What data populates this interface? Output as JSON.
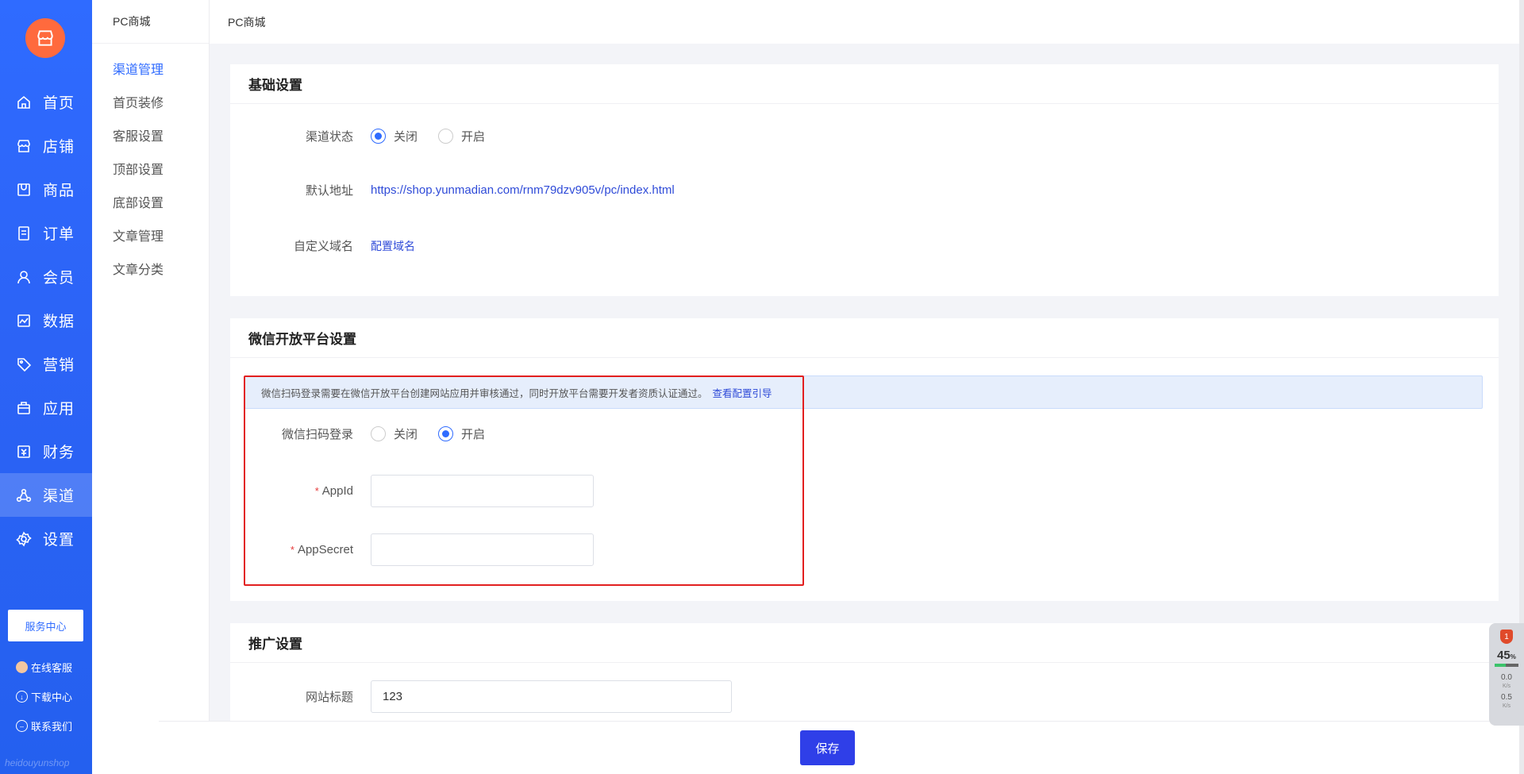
{
  "sidebar": {
    "items": [
      {
        "label": "首页",
        "icon": "home-icon"
      },
      {
        "label": "店铺",
        "icon": "store-icon"
      },
      {
        "label": "商品",
        "icon": "goods-icon"
      },
      {
        "label": "订单",
        "icon": "order-icon"
      },
      {
        "label": "会员",
        "icon": "member-icon"
      },
      {
        "label": "数据",
        "icon": "chart-icon"
      },
      {
        "label": "营销",
        "icon": "tag-icon"
      },
      {
        "label": "应用",
        "icon": "app-icon"
      },
      {
        "label": "财务",
        "icon": "finance-icon"
      },
      {
        "label": "渠道",
        "icon": "channel-icon"
      },
      {
        "label": "设置",
        "icon": "settings-icon"
      }
    ],
    "active": "渠道",
    "service_center": "服务中心",
    "online_service": "在线客服",
    "download_center": "下载中心",
    "contact_us": "联系我们",
    "watermark": "heidouyunshop"
  },
  "submenu": {
    "title": "PC商城",
    "items": [
      "渠道管理",
      "首页装修",
      "客服设置",
      "顶部设置",
      "底部设置",
      "文章管理",
      "文章分类"
    ],
    "active": "渠道管理"
  },
  "topbar": {
    "breadcrumb": "PC商城"
  },
  "basic": {
    "title": "基础设置",
    "status_label": "渠道状态",
    "status_options": [
      "关闭",
      "开启"
    ],
    "status_selected": "关闭",
    "default_address_label": "默认地址",
    "default_address": "https://shop.yunmadian.com/rnm79dzv905v/pc/index.html",
    "custom_domain_label": "自定义域名",
    "custom_domain_link": "配置域名"
  },
  "wechat": {
    "title": "微信开放平台设置",
    "notice": "微信扫码登录需要在微信开放平台创建网站应用并审核通过，同时开放平台需要开发者资质认证通过。",
    "notice_link": "查看配置引导",
    "scan_login_label": "微信扫码登录",
    "scan_options": [
      "关闭",
      "开启"
    ],
    "scan_selected": "开启",
    "appid_label": "AppId",
    "appid_value": "",
    "appsecret_label": "AppSecret",
    "appsecret_value": ""
  },
  "promo": {
    "title": "推广设置",
    "site_title_label": "网站标题",
    "site_title_value": "123"
  },
  "footer": {
    "save_label": "保存"
  },
  "widget": {
    "percent": "45",
    "percent_unit": "%",
    "memory_fill": 0.45,
    "up_speed": "0.0",
    "down_speed": "0.5",
    "speed_unit": "K/s",
    "badge": "1"
  },
  "colors": {
    "primary": "#2f6bff",
    "save": "#2f3fe8",
    "highlight": "#e21f1f",
    "logo": "#ff6a3d"
  }
}
